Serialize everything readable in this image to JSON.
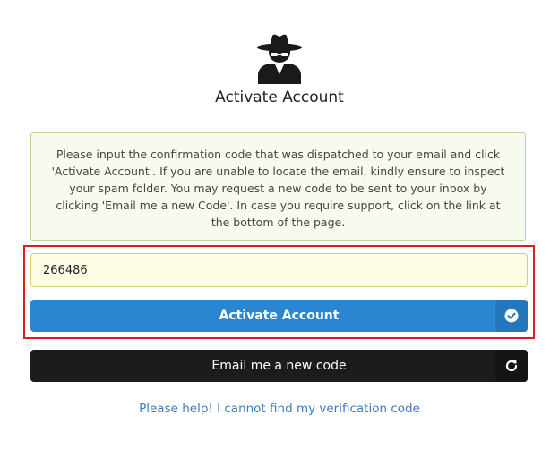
{
  "header": {
    "icon": "spy-agent-icon",
    "title": "Activate Account"
  },
  "info": {
    "message": "Please input the confirmation code that was dispatched to your email and click 'Activate Account'. If you are unable to locate the email, kindly ensure to inspect your spam folder. You may request a new code to be sent to your inbox by clicking 'Email me a new Code'. In case you require support, click on the link at the bottom of the page."
  },
  "form": {
    "code_value": "266486",
    "activate_label": "Activate Account",
    "activate_icon": "check-circle-icon",
    "email_label": "Email me a new code",
    "email_icon": "refresh-icon"
  },
  "footer": {
    "help_link": "Please help! I cannot find my verification code"
  },
  "colors": {
    "activate_button": "#2a86d1",
    "email_button": "#1b1c1e",
    "highlight_border": "#e01b24",
    "link": "#3d7bc1"
  }
}
